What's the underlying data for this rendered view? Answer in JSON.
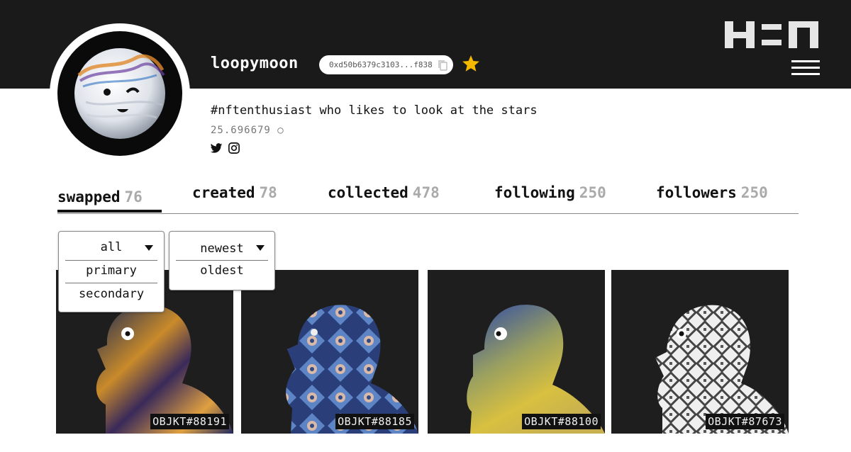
{
  "header": {
    "logo": "hic-et-nunc-logo",
    "menu_icon": "hamburger-icon"
  },
  "profile": {
    "username": "loopymoon",
    "wallet_address": "0xd50b6379c3103...f838",
    "bio": "#nftenthusiast who likes to look at the stars",
    "balance": "25.696679 ○",
    "social": [
      "twitter-icon",
      "instagram-icon"
    ]
  },
  "tabs": [
    {
      "label": "swapped",
      "count": "76"
    },
    {
      "label": "created",
      "count": "78"
    },
    {
      "label": "collected",
      "count": "478"
    },
    {
      "label": "following",
      "count": "250"
    },
    {
      "label": "followers",
      "count": "250"
    }
  ],
  "filters": {
    "type": {
      "selected": "all",
      "options": [
        "primary",
        "secondary"
      ]
    },
    "sort": {
      "selected": "newest",
      "options": [
        "oldest"
      ]
    }
  },
  "items": [
    {
      "label": "OBJKT#88191"
    },
    {
      "label": "OBJKT#88185"
    },
    {
      "label": "OBJKT#88100"
    },
    {
      "label": "OBJKT#87673"
    }
  ],
  "colors": {
    "topbar": "#1a1a1a",
    "star": "#f5b800",
    "accent_text": "#111111",
    "muted": "#aaaaaa"
  }
}
